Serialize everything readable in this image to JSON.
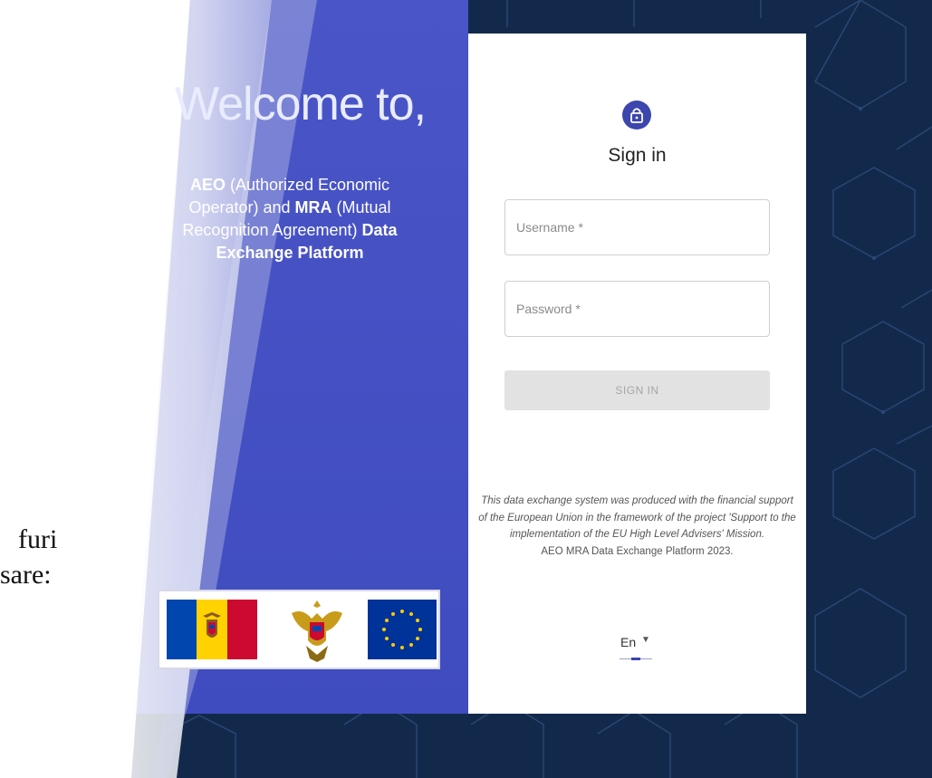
{
  "welcome": {
    "title": "Welcome to,",
    "desc_bold_1": "AEO",
    "desc_1": " (Authorized Economic Operator) and ",
    "desc_bold_2": "MRA",
    "desc_2": " (Mutual Recognition Agreement) ",
    "desc_bold_3": "Data Exchange Platform"
  },
  "side_text": {
    "line1": "furi",
    "line2": "sare:"
  },
  "signin": {
    "title": "Sign in",
    "username_placeholder": "Username *",
    "password_placeholder": "Password *",
    "button_label": "SIGN IN"
  },
  "footnote": {
    "italic": "This data exchange system was produced with the financial support of the European Union in the framework of the project 'Support to the implementation of the EU High Level Advisers' Mission.",
    "copyright": "AEO MRA Data Exchange Platform 2023."
  },
  "language": {
    "selected": "En"
  },
  "icons": {
    "lock": "lock-icon",
    "caret": "chevron-down-icon",
    "flag_md": "moldova-flag",
    "coat": "moldova-coat-of-arms",
    "flag_eu": "eu-flag"
  },
  "colors": {
    "accent": "#3c46ad",
    "background": "#13294b",
    "panel": "#4652c2"
  }
}
